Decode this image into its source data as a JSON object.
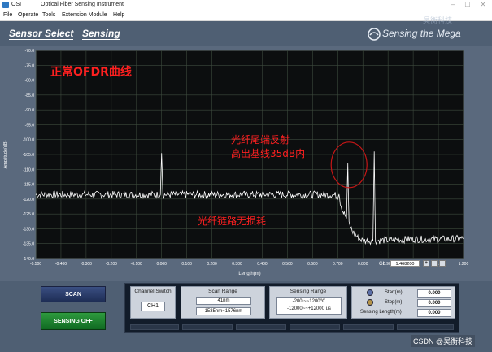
{
  "window": {
    "app_name": "OSI",
    "title": "Optical Fiber Sensing Instrument"
  },
  "menu": [
    "File",
    "Operate",
    "Tools",
    "Extension Module",
    "Help"
  ],
  "nav": {
    "sensor_select": "Sensor Select",
    "sensing": "Sensing"
  },
  "brand": {
    "text": "Sensing the Mega",
    "top_right": "昊衡科技"
  },
  "annotations": {
    "title": "正常OFDR曲线",
    "reflection_line1": "光纤尾端反射",
    "reflection_line2": "高出基线35dB内",
    "no_loss": "光纤链路无损耗"
  },
  "chart_data": {
    "type": "line",
    "xlabel": "Length(m)",
    "ylabel": "Amplitude(dB)",
    "xlim": [
      -0.5,
      1.2
    ],
    "ylim": [
      -140,
      -70
    ],
    "xticks": [
      "-0.500",
      "-0.400",
      "-0.300",
      "-0.200",
      "-0.100",
      "0.000",
      "0.100",
      "0.200",
      "0.300",
      "0.400",
      "0.500",
      "0.600",
      "0.700",
      "0.800",
      "0.900",
      "1.000",
      "1.100",
      "1.200"
    ],
    "yticks": [
      "-70.0",
      "-75.0",
      "-80.0",
      "-85.0",
      "-90.0",
      "-95.0",
      "-100.0",
      "-105.0",
      "-110.0",
      "-115.0",
      "-120.0",
      "-125.0",
      "-130.0",
      "-135.0",
      "-140.0"
    ],
    "grid": true,
    "series": [
      {
        "color": "#ffffff",
        "x": [
          -0.5,
          -0.3,
          -0.1,
          -0.005,
          0.0,
          0.005,
          0.2,
          0.4,
          0.6,
          0.68,
          0.7,
          0.705,
          0.71,
          0.72,
          0.735,
          0.74,
          0.745,
          0.76,
          0.78,
          0.8,
          0.84,
          0.845,
          0.85,
          0.9,
          1.0,
          1.1,
          1.2
        ],
        "y": [
          -118.5,
          -118.5,
          -118.5,
          -118.5,
          -104.5,
          -118.5,
          -118.5,
          -118.5,
          -118.5,
          -118.5,
          -119.0,
          -117.5,
          -121.0,
          -124.0,
          -126.5,
          -108.0,
          -128.5,
          -131.0,
          -133.0,
          -134.0,
          -134.0,
          -104.0,
          -134.0,
          -133.8,
          -133.5,
          -133.5,
          -133.3
        ]
      }
    ],
    "gi_label": "GI",
    "gi_value": "1.468200"
  },
  "controls": {
    "scan": "SCAN",
    "sensing_off": "SENSING OFF",
    "channel_switch_title": "Channel Switch",
    "channel_value": "CH1",
    "scan_range_title": "Scan Range",
    "scan_range_1": "41nm",
    "scan_range_2": "1535nm~1576nm",
    "sensing_range_title": "Sensing  Range",
    "sensing_range_1": "-200 ~~1200℃",
    "sensing_range_2": "-12000~~+12000 us",
    "start_label": "Start(m)",
    "start_value": "0.000",
    "stop_label": "Stop(m)",
    "stop_value": "0.000",
    "sensing_length_label": "Sensing Length(m)",
    "sensing_length_value": "0.000"
  },
  "watermark": "CSDN @昊衡科技",
  "colors": {
    "background": "#4f5f73",
    "plot_bg": "#0c0e0f",
    "grid": "#3d4a3d",
    "annotation": "#ff2020",
    "circle": "#c41616"
  }
}
